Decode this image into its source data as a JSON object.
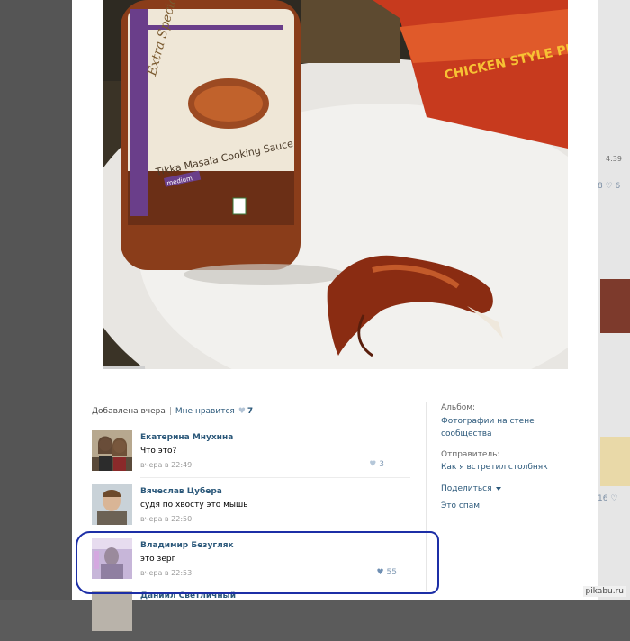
{
  "background": {
    "timestamp": "4:39",
    "like_text_1": "8 ♡ 6",
    "like_text_2": "16 ♡"
  },
  "photo_labels": {
    "jar_label_top": "Extra Special",
    "jar_label_main": "Tikka Masala Cooking Sauce",
    "jar_label_badge": "medium",
    "box_label": "CHICKEN STYLE PIECES"
  },
  "stats": {
    "added": "Добавлена вчера",
    "separator": "|",
    "like_link": "Мне нравится",
    "like_count": "7"
  },
  "comments": [
    {
      "author": "Екатерина Мнухина",
      "text": "Что это?",
      "time": "вчера в 22:49",
      "likes": "3"
    },
    {
      "author": "Вячеслав Цубера",
      "text": "судя по хвосту это мышь",
      "time": "вчера в 22:50",
      "likes": ""
    },
    {
      "author": "Владимир Безугляк",
      "text": "это зерг",
      "time": "вчера в 22:53",
      "likes": "55"
    },
    {
      "author": "Даниил Светличный"
    }
  ],
  "sidebar": {
    "album_label": "Альбом:",
    "album_value_1": "Фотографии на стене",
    "album_value_2": "сообщества",
    "sender_label": "Отправитель:",
    "sender_value": "Как я встретил столбняк",
    "share": "Поделиться",
    "spam": "Это спам"
  },
  "watermark": "pikabu.ru",
  "colors": {
    "link": "#2b587a",
    "highlight": "#1c2ea6"
  }
}
